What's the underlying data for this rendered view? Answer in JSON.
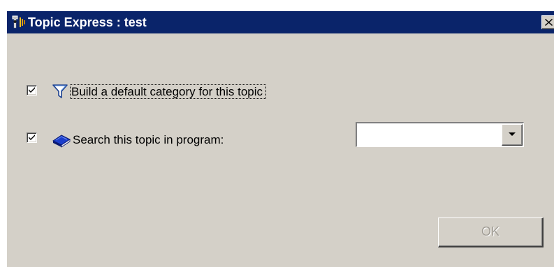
{
  "window": {
    "title": "Topic Express : test",
    "app_icon": "topic-express-icon",
    "close_icon": "close-icon"
  },
  "options": [
    {
      "label": "Build a default category for this topic",
      "checked": true,
      "icon": "funnel-icon",
      "focused": true
    },
    {
      "label": "Search this topic in program:",
      "checked": true,
      "icon": "book-icon"
    }
  ],
  "program_select": {
    "value": "",
    "arrow_icon": "chevron-down-icon"
  },
  "ok_button": {
    "label": "OK",
    "enabled": false
  },
  "colors": {
    "title_bar": "#0a246a",
    "dialog_background": "#d4d0c8",
    "disabled_text": "#a09c94"
  }
}
